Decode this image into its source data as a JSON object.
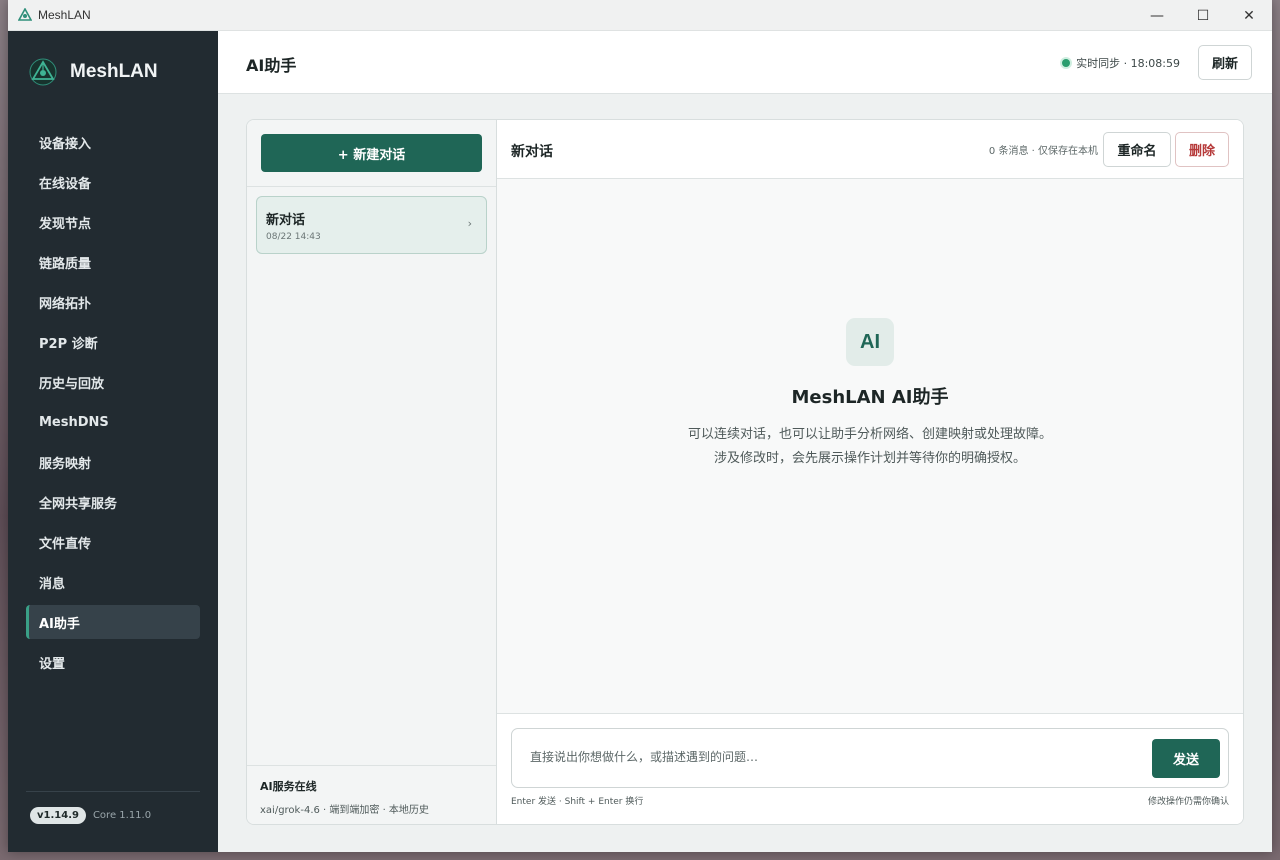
{
  "window": {
    "title": "MeshLAN",
    "controls": {
      "minimize": "—",
      "maximize": "☐",
      "close": "✕"
    }
  },
  "sidebar": {
    "brand": "MeshLAN",
    "items": [
      {
        "label": "设备接入",
        "active": false
      },
      {
        "label": "在线设备",
        "active": false
      },
      {
        "label": "发现节点",
        "active": false
      },
      {
        "label": "链路质量",
        "active": false
      },
      {
        "label": "网络拓扑",
        "active": false
      },
      {
        "label": "P2P 诊断",
        "active": false
      },
      {
        "label": "历史与回放",
        "active": false
      },
      {
        "label": "MeshDNS",
        "active": false
      },
      {
        "label": "服务映射",
        "active": false
      },
      {
        "label": "全网共享服务",
        "active": false
      },
      {
        "label": "文件直传",
        "active": false
      },
      {
        "label": "消息",
        "active": false
      },
      {
        "label": "AI助手",
        "active": true
      },
      {
        "label": "设置",
        "active": false
      }
    ],
    "version": "v1.14.9",
    "core_version": "Core 1.11.0"
  },
  "header": {
    "title": "AI助手",
    "sync_status": "实时同步 · 18:08:59",
    "refresh_label": "刷新"
  },
  "conversations": {
    "new_chat_label": "+ 新建对话",
    "items": [
      {
        "title": "新对话",
        "time": "08/22 14:43",
        "chevron": "›"
      }
    ],
    "service_title": "AI服务在线",
    "service_detail": "xai/grok-4.6 · 端到端加密 · 本地历史"
  },
  "chat": {
    "title": "新对话",
    "meta": "0 条消息 · 仅保存在本机",
    "rename_label": "重命名",
    "delete_label": "删除",
    "empty": {
      "badge": "AI",
      "title": "MeshLAN AI助手",
      "line1": "可以连续对话，也可以让助手分析网络、创建映射或处理故障。",
      "line2": "涉及修改时，会先展示操作计划并等待你的明确授权。"
    },
    "composer": {
      "placeholder": "直接说出你想做什么，或描述遇到的问题…",
      "value": "",
      "send_label": "发送",
      "hint_left": "Enter 发送 · Shift + Enter 换行",
      "hint_right": "修改操作仍需你确认"
    }
  },
  "colors": {
    "accent": "#1f6656",
    "sidebar_bg": "#222b31",
    "danger": "#b63a3a",
    "online": "#2a9d6e"
  }
}
